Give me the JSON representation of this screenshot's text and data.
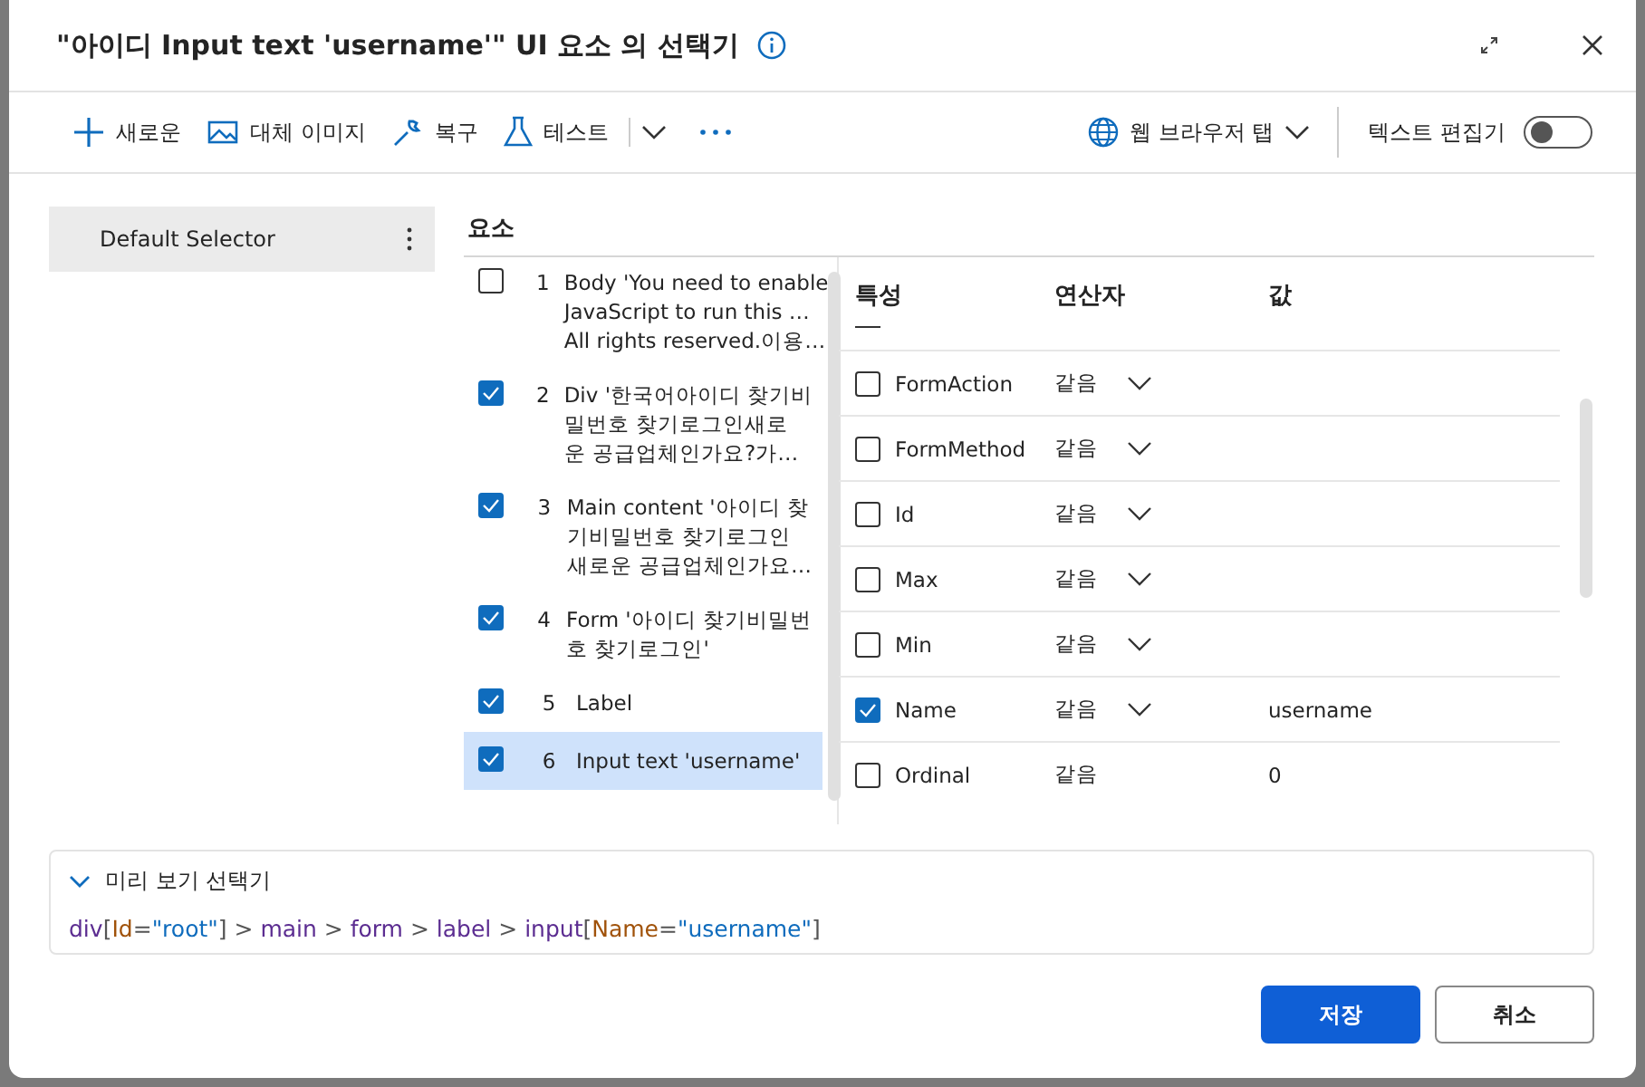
{
  "dialog": {
    "title": "\"아이디 Input text 'username'\" UI 요소 의 선택기"
  },
  "toolbar": {
    "left": [
      {
        "kind": "plus",
        "label": "새로운"
      },
      {
        "kind": "image",
        "label": "대체 이미지"
      },
      {
        "kind": "wrench",
        "label": "복구"
      },
      {
        "kind": "flask",
        "label": "테스트"
      }
    ],
    "browser": "웹 브라우저 탭",
    "text_editor": {
      "label": "텍스트 편집기",
      "on": false
    }
  },
  "selectors": [
    {
      "label": "Default Selector",
      "selected": true
    }
  ],
  "elements": {
    "heading": "요소",
    "items": [
      {
        "number": "1",
        "lines": [
          "Body 'You need to enable",
          "JavaScript to run this  …",
          "All rights reserved.이용…"
        ],
        "checked": false,
        "selected": false
      },
      {
        "number": "2",
        "lines": [
          "Div '한국어아이디 찾기비",
          "밀번호 찾기로그인새로",
          "운 공급업체인가요?가…"
        ],
        "checked": true,
        "selected": false
      },
      {
        "number": "3",
        "lines": [
          "Main content '아이디 찾",
          "기비밀번호 찾기로그인",
          "새로운 공급업체인가요…"
        ],
        "checked": true,
        "selected": false
      },
      {
        "number": "4",
        "lines": [
          "Form '아이디 찾기비밀번",
          "호 찾기로그인'"
        ],
        "checked": true,
        "selected": false
      },
      {
        "number": "5",
        "lines": [
          "Label"
        ],
        "checked": true,
        "selected": false
      },
      {
        "number": "6",
        "lines": [
          "Input text 'username'"
        ],
        "checked": true,
        "selected": true
      }
    ]
  },
  "attributes": {
    "columns": [
      "특성",
      "연산자",
      "값"
    ],
    "rows": [
      {
        "name": "FormAction",
        "operator": "같음",
        "dropdown": true,
        "checked": false
      },
      {
        "name": "FormMethod",
        "operator": "같음",
        "dropdown": true,
        "checked": false
      },
      {
        "name": "Id",
        "operator": "같음",
        "dropdown": true,
        "checked": false
      },
      {
        "name": "Max",
        "operator": "같음",
        "dropdown": true,
        "checked": false
      },
      {
        "name": "Min",
        "operator": "같음",
        "dropdown": true,
        "checked": false
      },
      {
        "name": "Name",
        "operator": "같음",
        "dropdown": true,
        "checked": true,
        "value": "username"
      },
      {
        "name": "Ordinal",
        "operator": "같음",
        "dropdown": false,
        "checked": false,
        "value": "0"
      }
    ]
  },
  "preview": {
    "label": "미리 보기 선택기",
    "expanded": true,
    "tokens": [
      {
        "kind": "tag",
        "text": "div"
      },
      {
        "kind": "punct",
        "text": "["
      },
      {
        "kind": "attr",
        "text": "Id"
      },
      {
        "kind": "punct",
        "text": "="
      },
      {
        "kind": "string",
        "text": "\"root\""
      },
      {
        "kind": "punct",
        "text": "] > "
      },
      {
        "kind": "tag",
        "text": "main"
      },
      {
        "kind": "punct",
        "text": " > "
      },
      {
        "kind": "tag",
        "text": "form"
      },
      {
        "kind": "punct",
        "text": " > "
      },
      {
        "kind": "tag",
        "text": "label"
      },
      {
        "kind": "punct",
        "text": " > "
      },
      {
        "kind": "tag",
        "text": "input"
      },
      {
        "kind": "punct",
        "text": "["
      },
      {
        "kind": "attr",
        "text": "Name"
      },
      {
        "kind": "punct",
        "text": "="
      },
      {
        "kind": "string",
        "text": "\"username\""
      },
      {
        "kind": "punct",
        "text": "]"
      }
    ]
  },
  "buttons": [
    {
      "label": "저장",
      "primary": true
    },
    {
      "label": "취소",
      "primary": false
    }
  ]
}
